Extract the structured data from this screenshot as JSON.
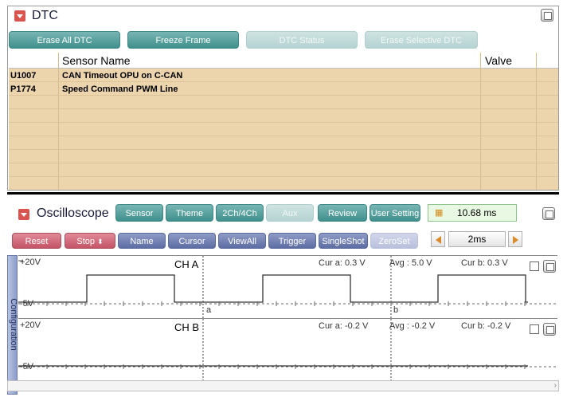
{
  "dtc": {
    "title": "DTC",
    "buttons": [
      {
        "label": "Erase All DTC",
        "enabled": true
      },
      {
        "label": "Freeze Frame",
        "enabled": true
      },
      {
        "label": "DTC Status",
        "enabled": false
      },
      {
        "label": "Erase Selective DTC",
        "enabled": false
      }
    ],
    "columns": {
      "sensor_name": "Sensor Name",
      "valve": "Valve"
    },
    "rows": [
      {
        "code": "U1007",
        "name": "CAN Timeout OPU on C-CAN"
      },
      {
        "code": "P1774",
        "name": "Speed Command PWM Line"
      }
    ]
  },
  "oscilloscope": {
    "title": "Oscilloscope",
    "top_buttons": [
      {
        "label": "Sensor",
        "enabled": true
      },
      {
        "label": "Theme",
        "enabled": true
      },
      {
        "label": "2Ch/4Ch",
        "enabled": true
      },
      {
        "label": "Aux",
        "enabled": false
      },
      {
        "label": "Review",
        "enabled": true
      },
      {
        "label": "User Setting",
        "enabled": true
      }
    ],
    "time_readout": "10.68 ms",
    "reset_label": "Reset",
    "stop_label": "Stop",
    "control_buttons": [
      {
        "label": "Name",
        "enabled": true
      },
      {
        "label": "Cursor",
        "enabled": true
      },
      {
        "label": "ViewAll",
        "enabled": true
      },
      {
        "label": "Trigger",
        "enabled": true
      },
      {
        "label": "SingleShot",
        "enabled": true
      },
      {
        "label": "ZeroSet",
        "enabled": false
      }
    ],
    "timebase": "2ms",
    "side_tab": "Configuration",
    "channels": [
      {
        "name": "CH A",
        "top_label": "+20V",
        "bottom_label": "-5V",
        "cur_a": "Cur a: 0.3 V",
        "avg": "Avg : 5.0 V",
        "cur_b": "Cur b: 0.3 V",
        "cursor_a": "a",
        "cursor_b": "b",
        "signal": "square"
      },
      {
        "name": "CH B",
        "top_label": "+20V",
        "bottom_label": "-5V",
        "cur_a": "Cur a: -0.2 V",
        "avg": "Avg : -0.2 V",
        "cur_b": "Cur b: -0.2 V",
        "signal": "flat"
      }
    ]
  },
  "colors": {
    "teal_button": "#3f8f8c",
    "pink_button": "#c45366",
    "blue_button": "#5d6da3",
    "table_fill": "#ecd4ad",
    "title_icon": "#d9534f"
  }
}
